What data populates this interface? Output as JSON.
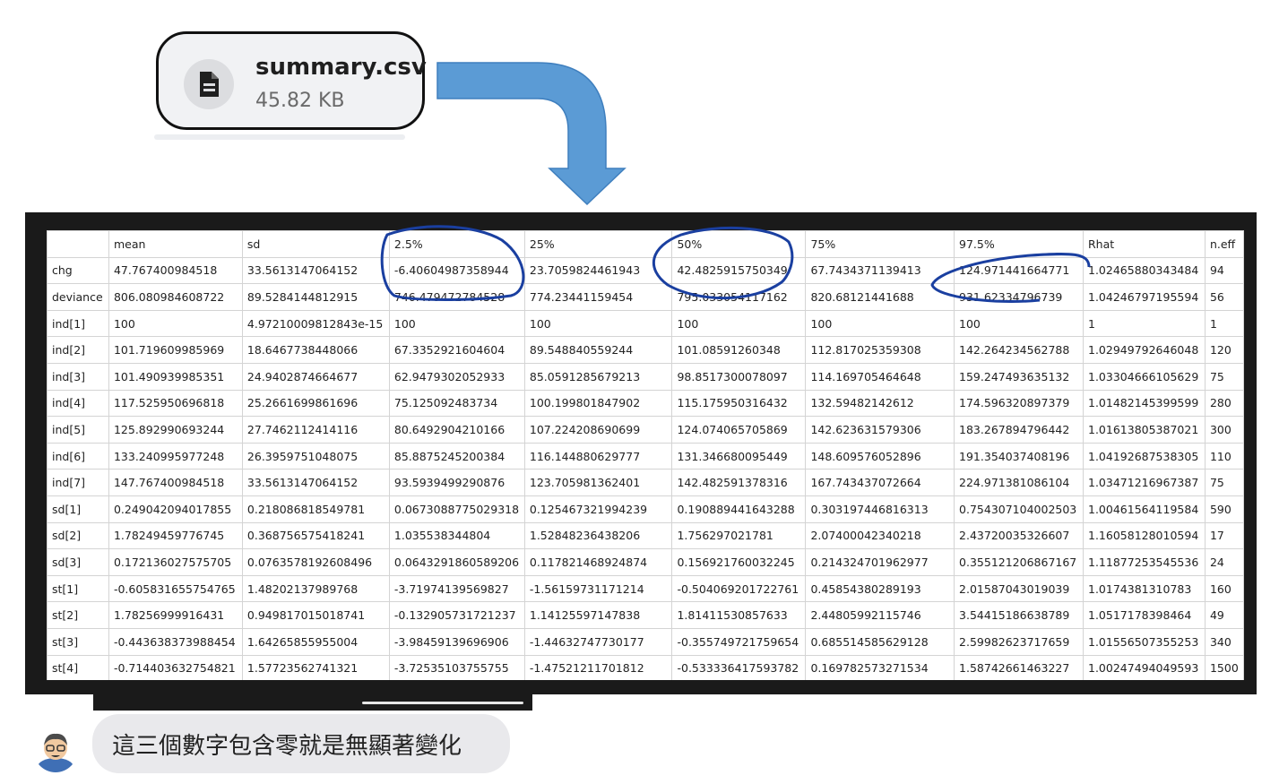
{
  "file": {
    "name": "summary.csv",
    "size": "45.82 KB",
    "icon": "document-icon"
  },
  "table": {
    "headers": [
      "",
      "mean",
      "sd",
      "2.5%",
      "25%",
      "50%",
      "75%",
      "97.5%",
      "Rhat",
      "n.eff"
    ],
    "rows": [
      [
        "chg",
        "47.767400984518",
        "33.5613147064152",
        "-6.40604987358944",
        "23.7059824461943",
        "42.4825915750349",
        "67.7434371139413",
        "124.971441664771",
        "1.02465880343484",
        "94"
      ],
      [
        "deviance",
        "806.080984608722",
        "89.5284144812915",
        "746.479472784528",
        "774.23441159454",
        "795.033054117162",
        "820.68121441688",
        "931.62334796739",
        "1.04246797195594",
        "56"
      ],
      [
        "ind[1]",
        "100",
        "4.97210009812843e-15",
        "100",
        "100",
        "100",
        "100",
        "100",
        "1",
        "1"
      ],
      [
        "ind[2]",
        "101.719609985969",
        "18.6467738448066",
        "67.3352921604604",
        "89.548840559244",
        "101.08591260348",
        "112.817025359308",
        "142.264234562788",
        "1.02949792646048",
        "120"
      ],
      [
        "ind[3]",
        "101.490939985351",
        "24.9402874664677",
        "62.9479302052933",
        "85.0591285679213",
        "98.8517300078097",
        "114.169705464648",
        "159.247493635132",
        "1.03304666105629",
        "75"
      ],
      [
        "ind[4]",
        "117.525950696818",
        "25.2661699861696",
        "75.125092483734",
        "100.199801847902",
        "115.175950316432",
        "132.59482142612",
        "174.596320897379",
        "1.01482145399599",
        "280"
      ],
      [
        "ind[5]",
        "125.892990693244",
        "27.7462112414116",
        "80.6492904210166",
        "107.224208690699",
        "124.074065705869",
        "142.623631579306",
        "183.267894796442",
        "1.01613805387021",
        "300"
      ],
      [
        "ind[6]",
        "133.240995977248",
        "26.3959751048075",
        "85.8875245200384",
        "116.144880629777",
        "131.346680095449",
        "148.609576052896",
        "191.354037408196",
        "1.04192687538305",
        "110"
      ],
      [
        "ind[7]",
        "147.767400984518",
        "33.5613147064152",
        "93.5939499290876",
        "123.705981362401",
        "142.482591378316",
        "167.743437072664",
        "224.971381086104",
        "1.03471216967387",
        "75"
      ],
      [
        "sd[1]",
        "0.249042094017855",
        "0.218086818549781",
        "0.0673088775029318",
        "0.125467321994239",
        "0.190889441643288",
        "0.303197446816313",
        "0.754307104002503",
        "1.00461564119584",
        "590"
      ],
      [
        "sd[2]",
        "1.78249459776745",
        "0.368756575418241",
        "1.035538344804",
        "1.52848236438206",
        "1.756297021781",
        "2.07400042340218",
        "2.43720035326607",
        "1.16058128010594",
        "17"
      ],
      [
        "sd[3]",
        "0.172136027575705",
        "0.0763578192608496",
        "0.0643291860589206",
        "0.117821468924874",
        "0.156921760032245",
        "0.214324701962977",
        "0.355121206867167",
        "1.11877253545536",
        "24"
      ],
      [
        "st[1]",
        "-0.605831655754765",
        "1.48202137989768",
        "-3.71974139569827",
        "-1.56159731171214",
        "-0.504069201722761",
        "0.45854380289193",
        "2.01587043019039",
        "1.0174381310783",
        "160"
      ],
      [
        "st[2]",
        "1.78256999916431",
        "0.949817015018741",
        "-0.132905731721237",
        "1.14125597147838",
        "1.81411530857633",
        "2.44805992115746",
        "3.54415186638789",
        "1.0517178398464",
        "49"
      ],
      [
        "st[3]",
        "-0.443638373988454",
        "1.64265855955004",
        "-3.98459139696906",
        "-1.44632747730177",
        "-0.355749721759654",
        "0.685514585629128",
        "2.59982623717659",
        "1.01556507355253",
        "340"
      ],
      [
        "st[4]",
        "-0.714403632754821",
        "1.57723562741321",
        "-3.72535103755755",
        "-1.47521211701812",
        "-0.533336417593782",
        "0.169782573271534",
        "1.58742661463227",
        "1.00247494049593",
        "1500"
      ]
    ]
  },
  "message": {
    "text": "這三個數字包含零就是無顯著變化"
  },
  "colors": {
    "arrow": "#5b9bd5",
    "annotation": "#1a3fa0",
    "frame": "#1a1a1a",
    "bubble": "#e9e9ec"
  }
}
